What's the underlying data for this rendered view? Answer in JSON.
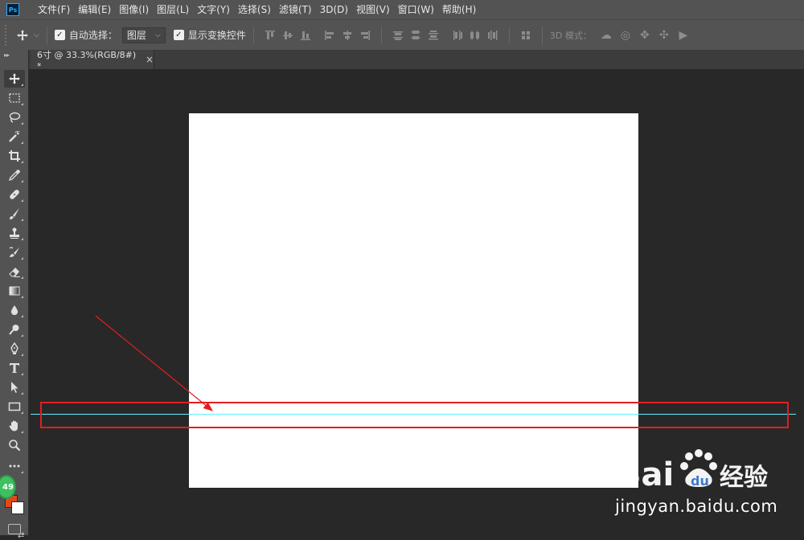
{
  "app": {
    "logo_text": "Ps"
  },
  "menu": [
    "文件(F)",
    "编辑(E)",
    "图像(I)",
    "图层(L)",
    "文字(Y)",
    "选择(S)",
    "滤镜(T)",
    "3D(D)",
    "视图(V)",
    "窗口(W)",
    "帮助(H)"
  ],
  "options": {
    "auto_select_label": "自动选择：",
    "auto_select_value": "图层",
    "show_transform_label": "显示变换控件",
    "mode3d_label": "3D 模式："
  },
  "document": {
    "tab_title": "6寸 @ 33.3%(RGB/8#) *"
  },
  "tools": [
    "move-tool",
    "marquee-tool",
    "lasso-tool",
    "magic-wand-tool",
    "crop-tool",
    "eyedropper-tool",
    "healing-brush-tool",
    "brush-tool",
    "clone-stamp-tool",
    "history-brush-tool",
    "eraser-tool",
    "gradient-tool",
    "blur-tool",
    "dodge-tool",
    "pen-tool",
    "type-tool",
    "path-selection-tool",
    "rectangle-tool",
    "hand-tool",
    "zoom-tool",
    "more-tools"
  ],
  "badge": "49",
  "colors": {
    "foreground": "#e8461a",
    "background": "#ffffff",
    "guide": "#5ff0ff",
    "annotation": "#e41e1e"
  },
  "watermark": {
    "brand": "Baidu经验",
    "url": "jingyan.baidu.com"
  }
}
